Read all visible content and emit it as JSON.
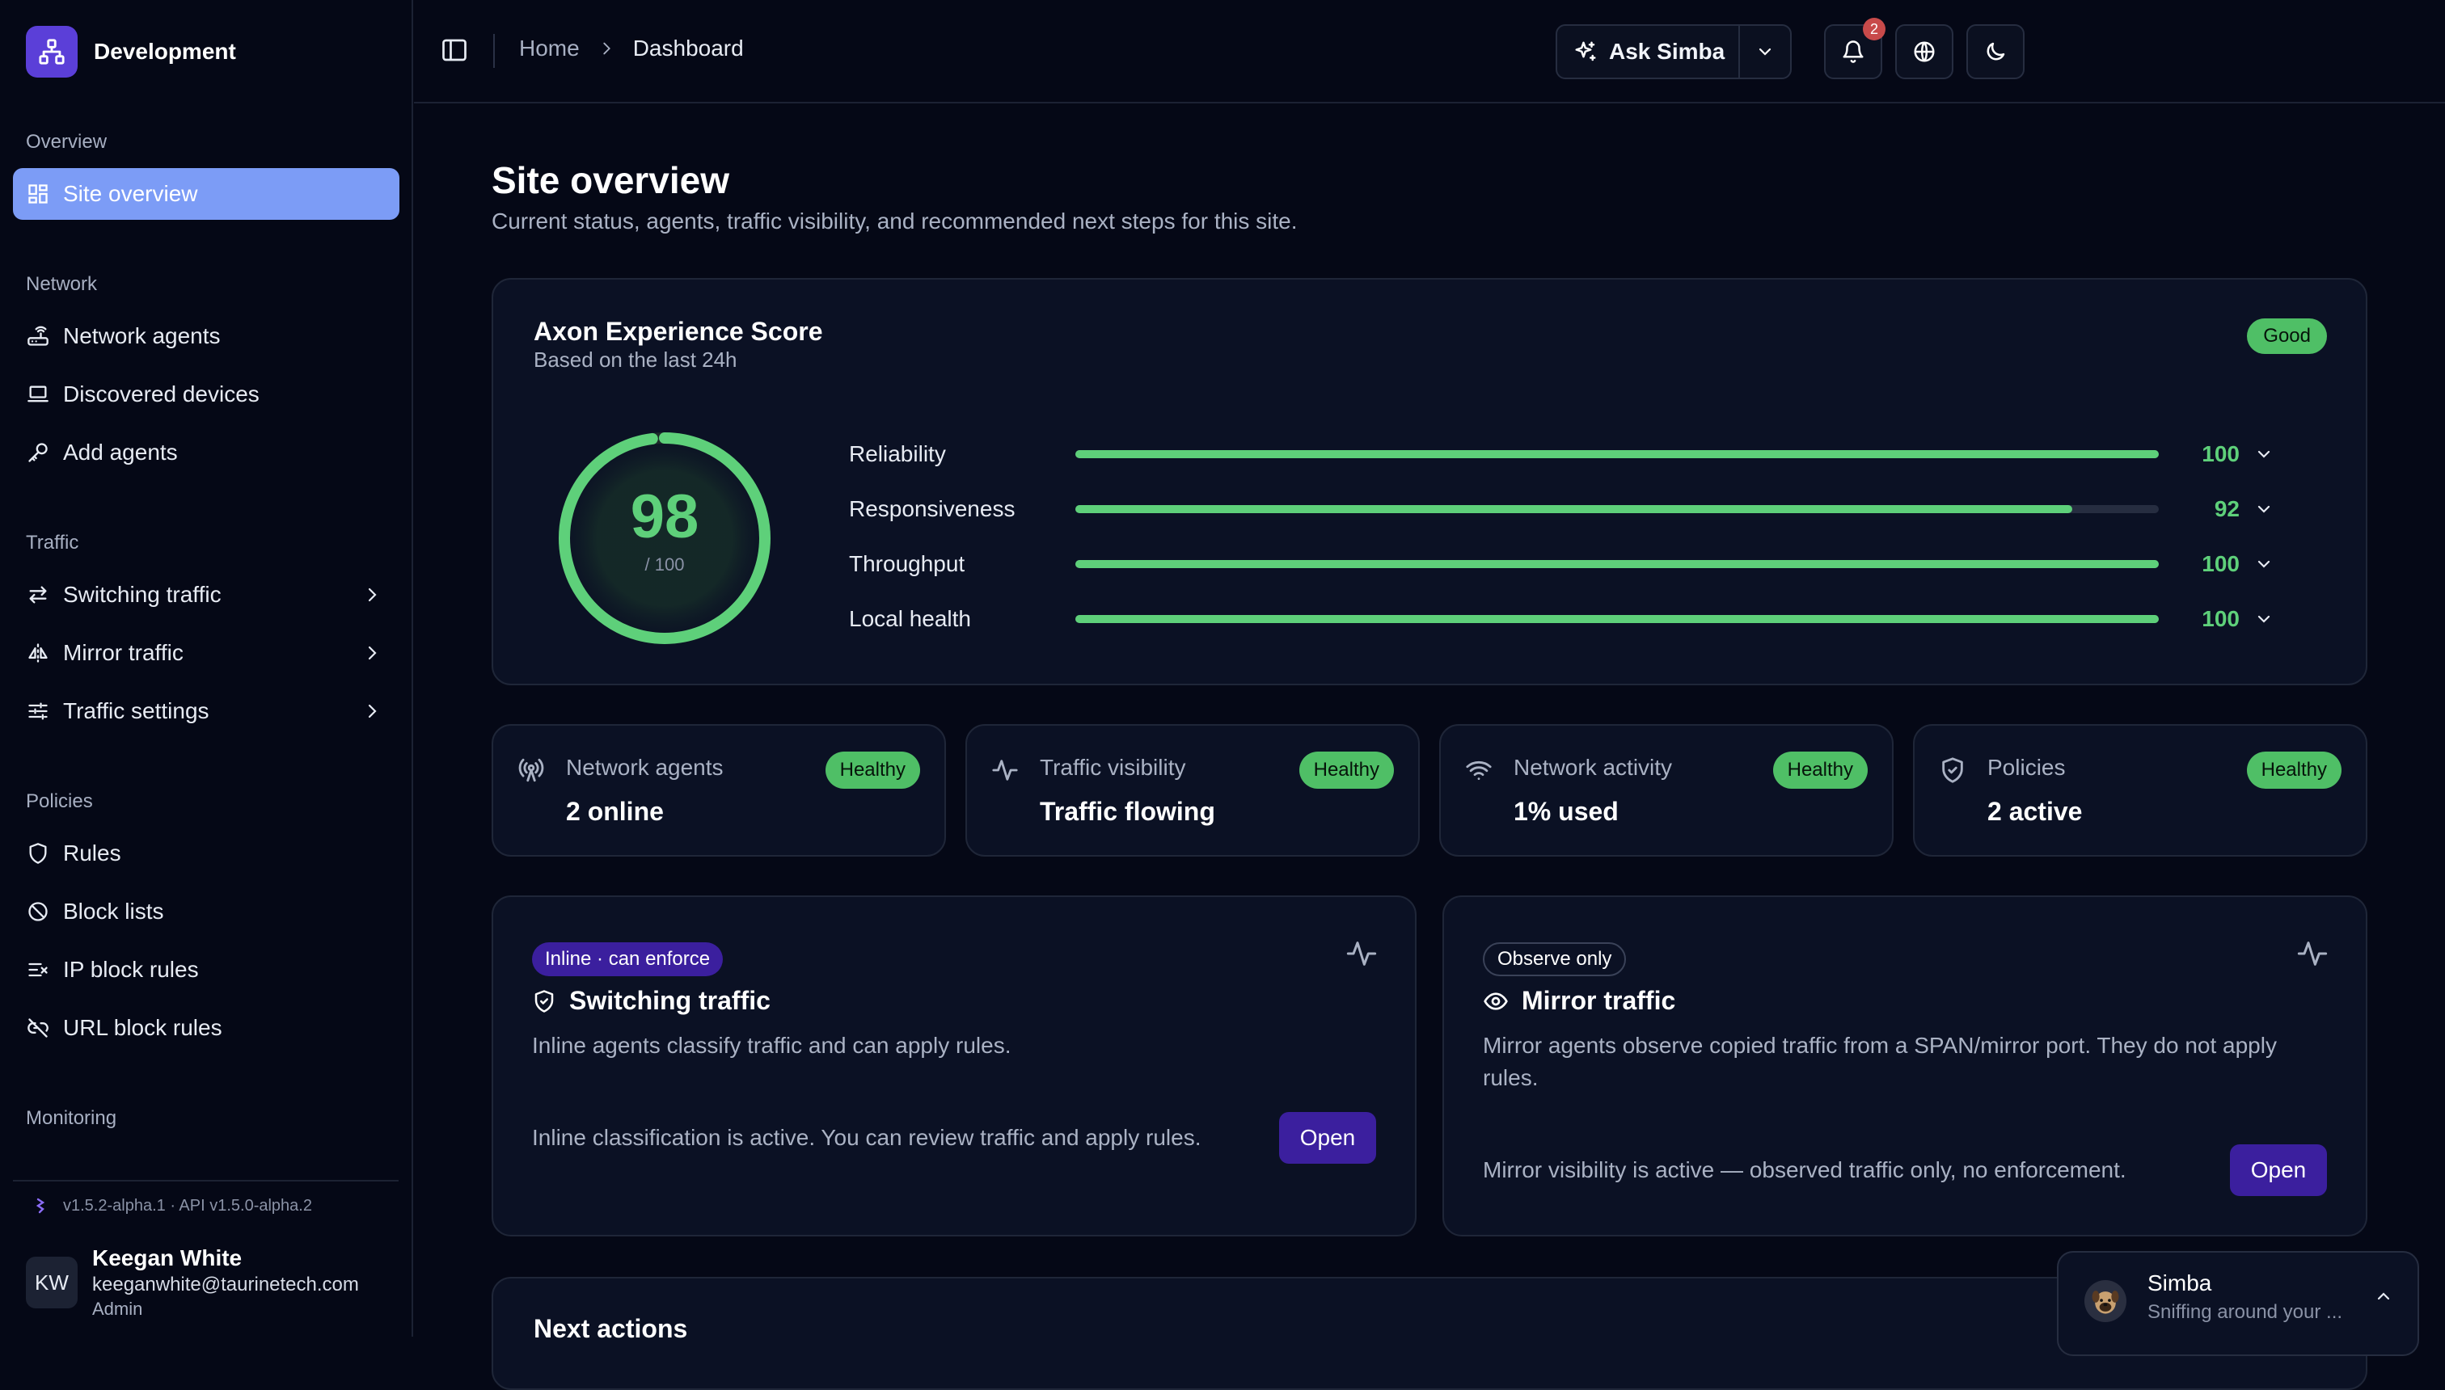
{
  "workspace": {
    "name": "Development"
  },
  "sidebar": {
    "sections": [
      {
        "title": "Overview",
        "items": [
          {
            "label": "Site overview",
            "icon": "dashboard-icon",
            "active": true
          }
        ]
      },
      {
        "title": "Network",
        "items": [
          {
            "label": "Network agents",
            "icon": "router-icon"
          },
          {
            "label": "Discovered devices",
            "icon": "laptop-icon"
          },
          {
            "label": "Add agents",
            "icon": "key-icon"
          }
        ]
      },
      {
        "title": "Traffic",
        "items": [
          {
            "label": "Switching traffic",
            "icon": "arrows-switch-icon"
          },
          {
            "label": "Mirror traffic",
            "icon": "mirror-icon"
          },
          {
            "label": "Traffic settings",
            "icon": "sliders-icon"
          }
        ]
      },
      {
        "title": "Policies",
        "items": [
          {
            "label": "Rules",
            "icon": "shield-icon"
          },
          {
            "label": "Block lists",
            "icon": "ban-icon"
          },
          {
            "label": "IP block rules",
            "icon": "list-x-icon"
          },
          {
            "label": "URL block rules",
            "icon": "link-off-icon"
          }
        ]
      },
      {
        "title": "Monitoring",
        "items": []
      }
    ],
    "version": "v1.5.2-alpha.1 · API v1.5.0-alpha.2",
    "user": {
      "initials": "KW",
      "name": "Keegan White",
      "email": "keeganwhite@taurinetech.com",
      "role": "Admin"
    }
  },
  "topbar": {
    "breadcrumb": [
      "Home",
      "Dashboard"
    ],
    "ask_label": "Ask Simba",
    "notifications": "2"
  },
  "page": {
    "title": "Site overview",
    "subtitle": "Current status, agents, traffic visibility, and recommended next steps for this site."
  },
  "score": {
    "title": "Axon Experience Score",
    "subtitle": "Based on the last 24h",
    "status": "Good",
    "value": "98",
    "denominator": "/ 100",
    "value_fraction": 0.98,
    "metrics": [
      {
        "label": "Reliability",
        "value": "100",
        "fraction": 1.0
      },
      {
        "label": "Responsiveness",
        "value": "92",
        "fraction": 0.92
      },
      {
        "label": "Throughput",
        "value": "100",
        "fraction": 1.0
      },
      {
        "label": "Local health",
        "value": "100",
        "fraction": 1.0
      }
    ]
  },
  "stats": [
    {
      "label": "Network agents",
      "value": "2 online",
      "status": "Healthy",
      "icon": "antenna-icon"
    },
    {
      "label": "Traffic visibility",
      "value": "Traffic flowing",
      "status": "Healthy",
      "icon": "pulse-icon"
    },
    {
      "label": "Network activity",
      "value": "1% used",
      "status": "Healthy",
      "icon": "wifi-icon"
    },
    {
      "label": "Policies",
      "value": "2 active",
      "status": "Healthy",
      "icon": "shield-check-icon"
    }
  ],
  "traffic_cards": [
    {
      "tag": "Inline · can enforce",
      "title": "Switching traffic",
      "desc": "Inline agents classify traffic and can apply rules.",
      "footer": "Inline classification is active. You can review traffic and apply rules.",
      "button": "Open"
    },
    {
      "tag": "Observe only",
      "title": "Mirror traffic",
      "desc": "Mirror agents observe copied traffic from a SPAN/mirror port. They do not apply rules.",
      "footer": "Mirror visibility is active — observed traffic only, no enforcement.",
      "button": "Open"
    }
  ],
  "next_actions": {
    "title": "Next actions"
  },
  "simba": {
    "name": "Simba",
    "subtitle": "Sniffing around your ..."
  },
  "colors": {
    "accent": "#7c9cf6",
    "good": "#4fbf66",
    "score": "#5ed07a",
    "primary_button": "#3b1f9e",
    "background": "#050816"
  }
}
